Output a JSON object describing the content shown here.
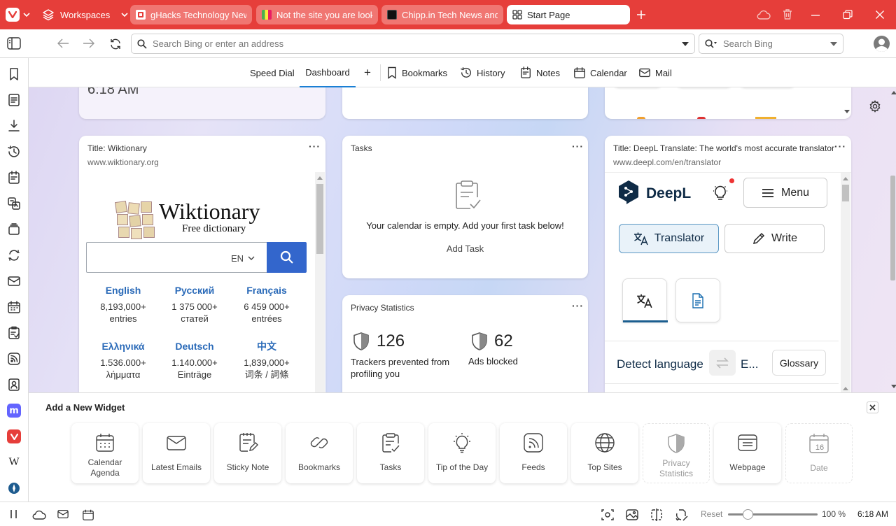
{
  "colors": {
    "accent": "#e63e3a",
    "link": "#2a6ab8",
    "deepl": "#0f2b46"
  },
  "tabbar": {
    "workspaces_label": "Workspaces",
    "tabs": [
      {
        "title": "gHacks Technology News a",
        "favicon": "ghacks-favicon"
      },
      {
        "title": "Not the site you are lookin",
        "favicon": "colorful-favicon"
      },
      {
        "title": "Chipp.in Tech News and Re",
        "favicon": "chipp-favicon"
      },
      {
        "title": "Start Page",
        "favicon": "grid-icon"
      }
    ]
  },
  "addressbar": {
    "placeholder": "Search Bing or enter an address",
    "search_placeholder": "Search Bing"
  },
  "nav": {
    "speed_dial": "Speed Dial",
    "dashboard": "Dashboard",
    "bookmarks": "Bookmarks",
    "history": "History",
    "notes": "Notes",
    "calendar": "Calendar",
    "mail": "Mail"
  },
  "clock_partial": "6:18 AM",
  "wiktionary": {
    "title": "Title: Wiktionary",
    "url": "www.wiktionary.org",
    "logo_name": "Wiktionary",
    "tagline": "Free dictionary",
    "lang_select": "EN",
    "languages": [
      {
        "name": "English",
        "count": "8,193,000+",
        "unit": "entries"
      },
      {
        "name": "Русский",
        "count": "1 375 000+",
        "unit": "статей"
      },
      {
        "name": "Français",
        "count": "6 459 000+",
        "unit": "entrées"
      },
      {
        "name": "Ελληνικά",
        "count": "1.536.000+",
        "unit": "λήμματα"
      },
      {
        "name": "Deutsch",
        "count": "1.140.000+",
        "unit": "Einträge"
      },
      {
        "name": "中文",
        "count": "1,839,000+",
        "unit": "词条 / 詞條"
      }
    ]
  },
  "tasks": {
    "title": "Tasks",
    "empty_msg": "Your calendar is empty. Add your first task below!",
    "add_label": "Add Task"
  },
  "privacy": {
    "title": "Privacy Statistics",
    "trackers_count": "126",
    "trackers_label": "Trackers prevented from profiling you",
    "ads_count": "62",
    "ads_label": "Ads blocked"
  },
  "deepl": {
    "title": "Title: DeepL Translate: The world's most accurate translator",
    "url": "www.deepl.com/en/translator",
    "brand": "DeepL",
    "menu": "Menu",
    "translator": "Translator",
    "write": "Write",
    "detect": "Detect language",
    "target_partial": "E...",
    "glossary": "Glossary"
  },
  "drawer": {
    "title": "Add a New Widget",
    "widgets": [
      {
        "label": "Calendar Agenda",
        "icon": "calendar-agenda-icon"
      },
      {
        "label": "Latest Emails",
        "icon": "envelope-icon"
      },
      {
        "label": "Sticky Note",
        "icon": "sticky-note-icon"
      },
      {
        "label": "Bookmarks",
        "icon": "link-icon"
      },
      {
        "label": "Tasks",
        "icon": "tasks-icon"
      },
      {
        "label": "Tip of the Day",
        "icon": "lightbulb-icon"
      },
      {
        "label": "Feeds",
        "icon": "rss-icon"
      },
      {
        "label": "Top Sites",
        "icon": "globe-icon"
      },
      {
        "label": "Privacy Statistics",
        "icon": "shield-icon"
      },
      {
        "label": "Webpage",
        "icon": "webpage-icon"
      },
      {
        "label": "Date",
        "icon": "date-icon",
        "date_number": "16"
      }
    ]
  },
  "statusbar": {
    "reset": "Reset",
    "zoom": "100 %",
    "time": "6:18 AM",
    "zoom_level": 0.22
  }
}
